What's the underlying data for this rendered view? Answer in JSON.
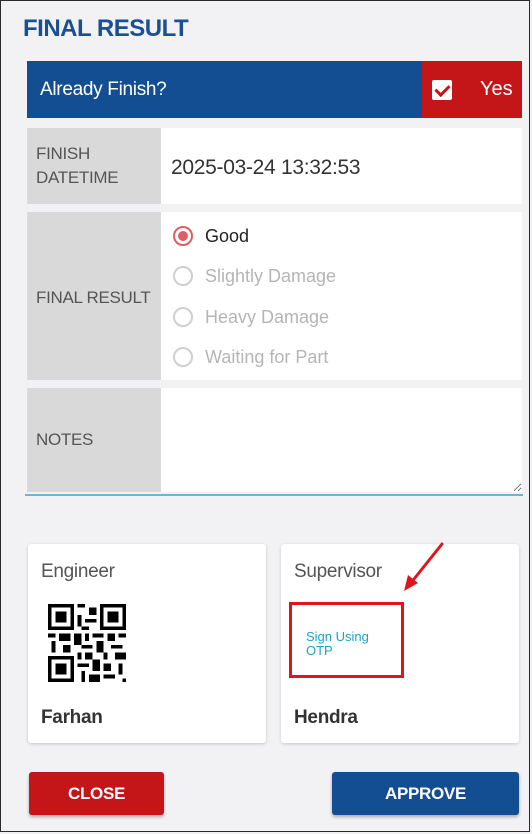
{
  "title": "FINAL RESULT",
  "finish_question": {
    "label": "Already Finish?",
    "checkbox_checked": true,
    "checkbox_label": "Yes"
  },
  "finish_datetime": {
    "label_line1": "FINISH",
    "label_line2": "DATETIME",
    "value": "2025-03-24 13:32:53"
  },
  "final_result": {
    "label": "FINAL RESULT",
    "selected": "Good",
    "options": [
      "Good",
      "Slightly Damage",
      "Heavy Damage",
      "Waiting for Part"
    ]
  },
  "notes": {
    "label": "NOTES",
    "value": ""
  },
  "engineer": {
    "role": "Engineer",
    "name": "Farhan",
    "signature_icon": "qr-code-icon"
  },
  "supervisor": {
    "role": "Supervisor",
    "name": "Hendra",
    "sign_link": "Sign Using OTP"
  },
  "buttons": {
    "close": "CLOSE",
    "approve": "APPROVE"
  },
  "colors": {
    "primary_blue": "#134d92",
    "danger_red": "#c41518",
    "radio_selected": "#e25c66",
    "link_teal": "#1aa3c8",
    "highlight_red": "#e0151b",
    "divider": "#6fb3d6"
  }
}
